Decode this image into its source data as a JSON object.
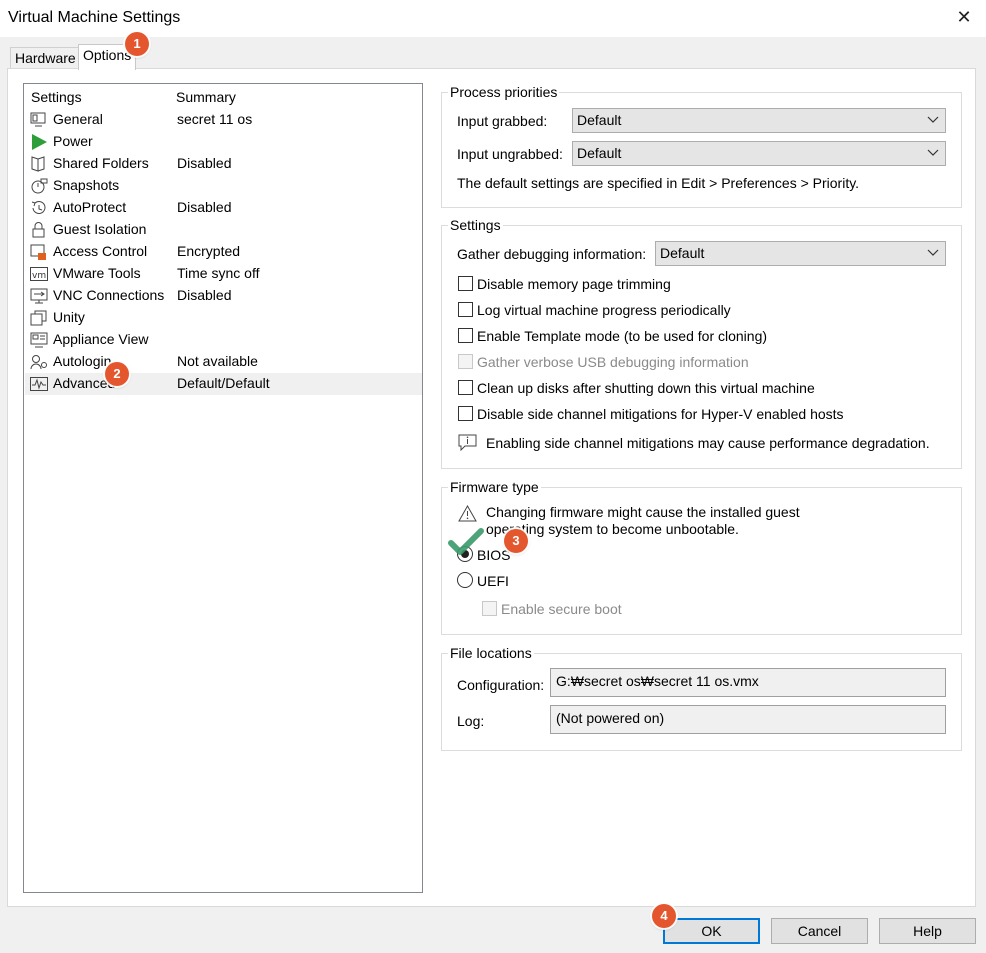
{
  "window": {
    "title": "Virtual Machine Settings"
  },
  "tabs": [
    {
      "label": "Hardware"
    },
    {
      "label": "Options",
      "active": true
    }
  ],
  "settings_list": {
    "headers": {
      "settings": "Settings",
      "summary": "Summary"
    },
    "items": [
      {
        "name": "General",
        "summary": "secret 11 os",
        "icon": "monitor-icon"
      },
      {
        "name": "Power",
        "summary": "",
        "icon": "play-icon"
      },
      {
        "name": "Shared Folders",
        "summary": "Disabled",
        "icon": "folder-icon"
      },
      {
        "name": "Snapshots",
        "summary": "",
        "icon": "snapshot-icon"
      },
      {
        "name": "AutoProtect",
        "summary": "Disabled",
        "icon": "clock-icon"
      },
      {
        "name": "Guest Isolation",
        "summary": "",
        "icon": "lock-icon"
      },
      {
        "name": "Access Control",
        "summary": "Encrypted",
        "icon": "access-control-icon"
      },
      {
        "name": "VMware Tools",
        "summary": "Time sync off",
        "icon": "vm-icon"
      },
      {
        "name": "VNC Connections",
        "summary": "Disabled",
        "icon": "vnc-icon"
      },
      {
        "name": "Unity",
        "summary": "",
        "icon": "unity-icon"
      },
      {
        "name": "Appliance View",
        "summary": "",
        "icon": "appliance-icon"
      },
      {
        "name": "Autologin",
        "summary": "Not available",
        "icon": "autologin-icon"
      },
      {
        "name": "Advanced",
        "summary": "Default/Default",
        "icon": "advanced-icon",
        "selected": true
      }
    ]
  },
  "process_priorities": {
    "title": "Process priorities",
    "grabbed_label": "Input grabbed:",
    "grabbed_value": "Default",
    "ungrabbed_label": "Input ungrabbed:",
    "ungrabbed_value": "Default",
    "note": "The default settings are specified in Edit > Preferences > Priority."
  },
  "settings_group": {
    "title": "Settings",
    "debug_label": "Gather debugging information:",
    "debug_value": "Default",
    "checkboxes": [
      {
        "label": "Disable memory page trimming",
        "checked": false,
        "enabled": true
      },
      {
        "label": "Log virtual machine progress periodically",
        "checked": false,
        "enabled": true
      },
      {
        "label": "Enable Template mode (to be used for cloning)",
        "checked": false,
        "enabled": true
      },
      {
        "label": "Gather verbose USB debugging information",
        "checked": false,
        "enabled": false
      },
      {
        "label": "Clean up disks after shutting down this virtual machine",
        "checked": false,
        "enabled": true
      },
      {
        "label": "Disable side channel mitigations for Hyper-V enabled hosts",
        "checked": false,
        "enabled": true
      }
    ],
    "info_note": "Enabling side channel mitigations may cause performance degradation."
  },
  "firmware": {
    "title": "Firmware type",
    "warning_line1": "Changing firmware might cause the installed guest",
    "warning_line2": "operating system to become unbootable.",
    "options": [
      {
        "label": "BIOS",
        "selected": true
      },
      {
        "label": "UEFI",
        "selected": false
      }
    ],
    "secure_boot_label": "Enable secure boot"
  },
  "file_locations": {
    "title": "File locations",
    "config_label": "Configuration:",
    "config_value": "G:₩secret os₩secret 11 os.vmx",
    "log_label": "Log:",
    "log_value": "(Not powered on)"
  },
  "buttons": {
    "ok": "OK",
    "cancel": "Cancel",
    "help": "Help"
  },
  "annotations": {
    "badge1": "1",
    "badge2": "2",
    "badge3": "3",
    "badge4": "4"
  },
  "colors": {
    "badge": "#e4572e",
    "checkmark": "#3a9a6a",
    "power_icon": "#2e9e3a",
    "default_button_border": "#0078d7"
  }
}
